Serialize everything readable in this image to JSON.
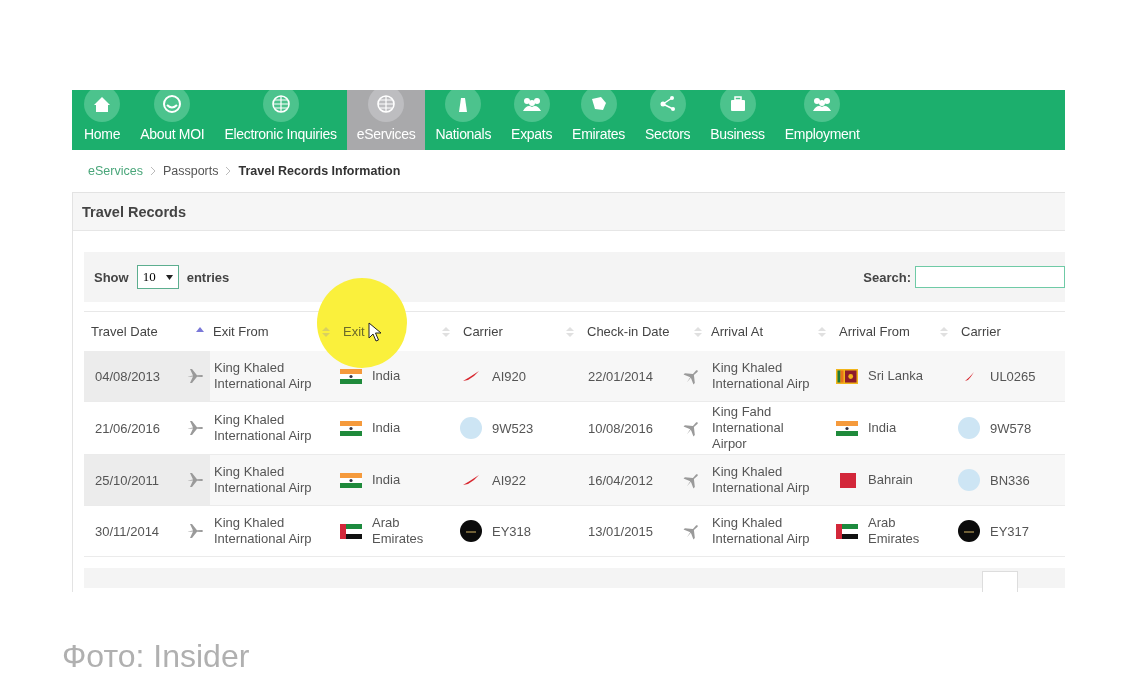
{
  "nav": {
    "items": [
      {
        "label": "Home",
        "selected": false
      },
      {
        "label": "About MOI",
        "selected": false
      },
      {
        "label": "Electronic Inquiries",
        "selected": false
      },
      {
        "label": "eServices",
        "selected": true
      },
      {
        "label": "Nationals",
        "selected": false
      },
      {
        "label": "Expats",
        "selected": false
      },
      {
        "label": "Emirates",
        "selected": false
      },
      {
        "label": "Sectors",
        "selected": false
      },
      {
        "label": "Business",
        "selected": false
      },
      {
        "label": "Employment",
        "selected": false
      }
    ]
  },
  "breadcrumb": [
    {
      "label": "eServices",
      "kind": "link"
    },
    {
      "label": "Passports",
      "kind": "link"
    },
    {
      "label": "Travel Records Information",
      "kind": "current"
    }
  ],
  "panel": {
    "title": "Travel Records"
  },
  "length_menu": {
    "before": "Show",
    "value": "10",
    "after": "entries"
  },
  "search": {
    "label": "Search:"
  },
  "table": {
    "columns": [
      {
        "label": "Travel Date",
        "sorted": true
      },
      {
        "label": "Exit From",
        "sorted": false
      },
      {
        "label": "Exit",
        "sorted": false
      },
      {
        "label": "Carrier",
        "sorted": false
      },
      {
        "label": "Check-in Date",
        "sorted": false
      },
      {
        "label": "Arrival At",
        "sorted": false
      },
      {
        "label": "Arrival From",
        "sorted": false
      },
      {
        "label": "Carrier"
      }
    ],
    "rows": [
      {
        "travel_date": "04/08/2013",
        "exit_from": "King Khaled International Airp",
        "exit_to": {
          "name": "India",
          "kind": "india"
        },
        "carrier": {
          "code": "AI920",
          "kind": "wing"
        },
        "checkin_date": "22/01/2014",
        "arrival_at": "King Khaled International Airp",
        "arrival_from": {
          "name": "Sri Lanka",
          "kind": "srilanka"
        },
        "carrier_2": {
          "code": "UL0265",
          "kind": "smallwing"
        }
      },
      {
        "travel_date": "21/06/2016",
        "exit_from": "King Khaled International Airp",
        "exit_to": {
          "name": "India",
          "kind": "india"
        },
        "carrier": {
          "code": "9W523",
          "kind": "light"
        },
        "checkin_date": "10/08/2016",
        "arrival_at": "King Fahd International Airpor",
        "arrival_from": {
          "name": "India",
          "kind": "india"
        },
        "carrier_2": {
          "code": "9W578",
          "kind": "light"
        }
      },
      {
        "travel_date": "25/10/2011",
        "exit_from": "King Khaled International Airp",
        "exit_to": {
          "name": "India",
          "kind": "india"
        },
        "carrier": {
          "code": "AI922",
          "kind": "wing"
        },
        "checkin_date": "16/04/2012",
        "arrival_at": "King Khaled International Airp",
        "arrival_from": {
          "name": "Bahrain",
          "kind": "bahrain"
        },
        "carrier_2": {
          "code": "BN336",
          "kind": "light"
        }
      },
      {
        "travel_date": "30/11/2014",
        "exit_from": "King Khaled International Airp",
        "exit_to": {
          "name": "Arab Emirates",
          "kind": "uae"
        },
        "carrier": {
          "code": "EY318",
          "kind": "dark"
        },
        "checkin_date": "13/01/2015",
        "arrival_at": "King Khaled International Airp",
        "arrival_from": {
          "name": "Arab Emirates",
          "kind": "uae"
        },
        "carrier_2": {
          "code": "EY317",
          "kind": "dark"
        }
      }
    ]
  },
  "credit": "Фото: Insider"
}
